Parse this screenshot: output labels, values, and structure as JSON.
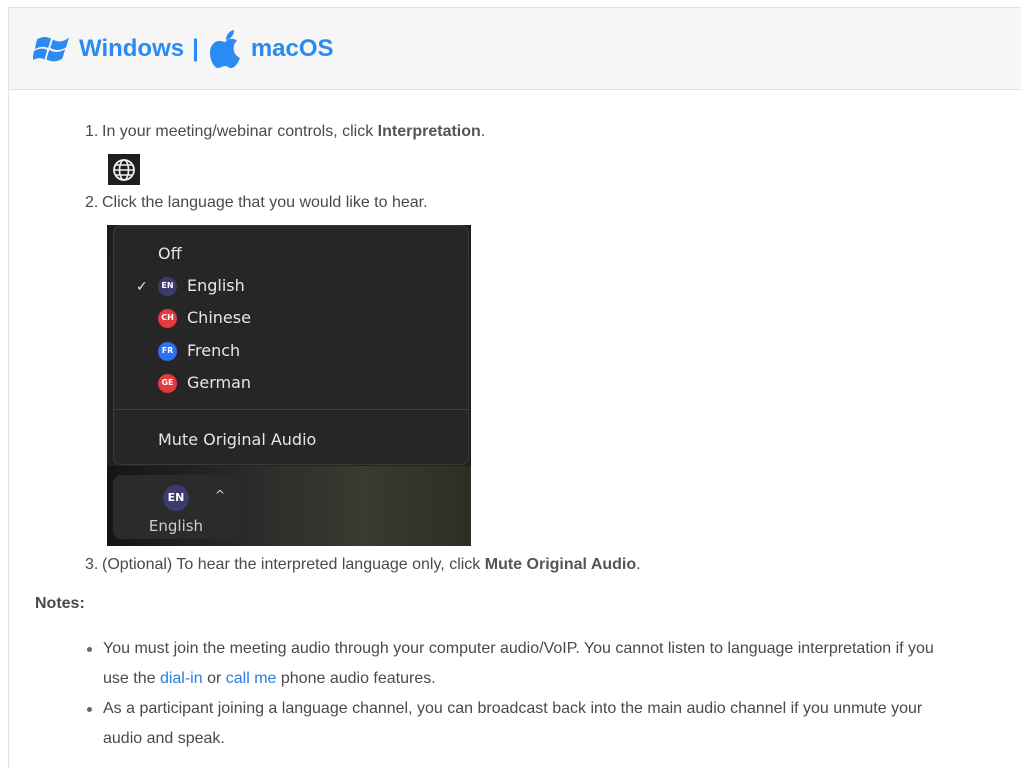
{
  "header": {
    "windows_label": "Windows",
    "separator": "|",
    "macos_label": "macOS",
    "accent_color": "#2a8bf2"
  },
  "steps": [
    {
      "number": "1.",
      "text_before": "In your meeting/webinar controls, click ",
      "bold": "Interpretation",
      "text_after": ".",
      "icon": "globe-icon"
    },
    {
      "number": "2.",
      "text": "Click the language that you would like to hear."
    },
    {
      "number": "3.",
      "text_before": "(Optional) To hear the interpreted language only, click ",
      "bold": "Mute Original Audio",
      "text_after": "."
    }
  ],
  "menu": {
    "off_label": "Off",
    "languages": [
      {
        "code": "EN",
        "name": "English",
        "color": "#3c3a6e",
        "selected": true
      },
      {
        "code": "CH",
        "name": "Chinese",
        "color": "#e5393b",
        "selected": false
      },
      {
        "code": "FR",
        "name": "French",
        "color": "#2f6ff0",
        "selected": false
      },
      {
        "code": "GE",
        "name": "German",
        "color": "#e5393b",
        "selected": false
      }
    ],
    "check_mark": "✓",
    "mute_label": "Mute Original Audio"
  },
  "language_button": {
    "code": "EN",
    "caret": "^",
    "label": "English"
  },
  "notes": {
    "title": "Notes:",
    "items": [
      {
        "text_before": "You must join the meeting audio through your computer audio/VoIP. You cannot listen to language interpretation if you use the ",
        "link1": "dial-in",
        "text_mid": " or ",
        "link2": "call me",
        "text_after": " phone audio features."
      },
      {
        "text": "As a participant joining a language channel, you can broadcast back into the main audio channel if you unmute your audio and speak."
      }
    ]
  }
}
